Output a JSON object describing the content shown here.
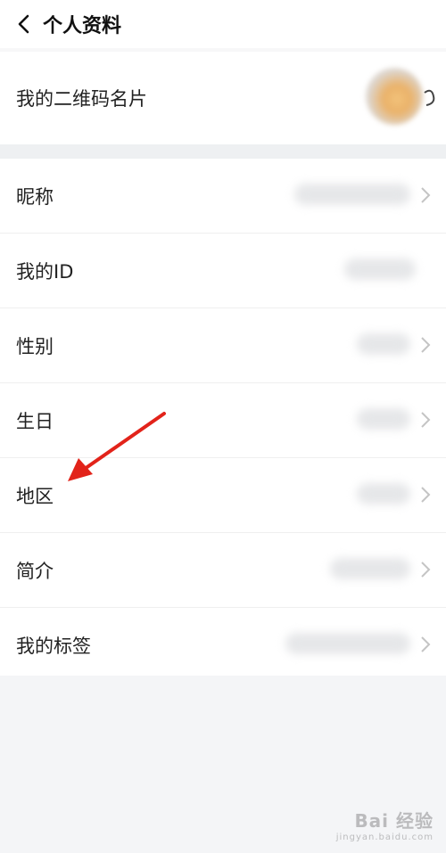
{
  "header": {
    "title": "个人资料"
  },
  "qr_row": {
    "label": "我的二维码名片"
  },
  "profile_items": [
    {
      "label": "我的ID",
      "key": "id"
    }
  ],
  "items": [
    {
      "label": "昵称"
    },
    {
      "label": "我的ID"
    },
    {
      "label": "性别"
    },
    {
      "label": "生日"
    },
    {
      "label": "地区"
    },
    {
      "label": "简介"
    },
    {
      "label": "我的标签"
    }
  ],
  "watermark": {
    "main": "Bai 经验",
    "sub": "jingyan.baidu.com"
  },
  "colors": {
    "annotation_arrow": "#e2231a",
    "background": "#f4f5f7"
  }
}
